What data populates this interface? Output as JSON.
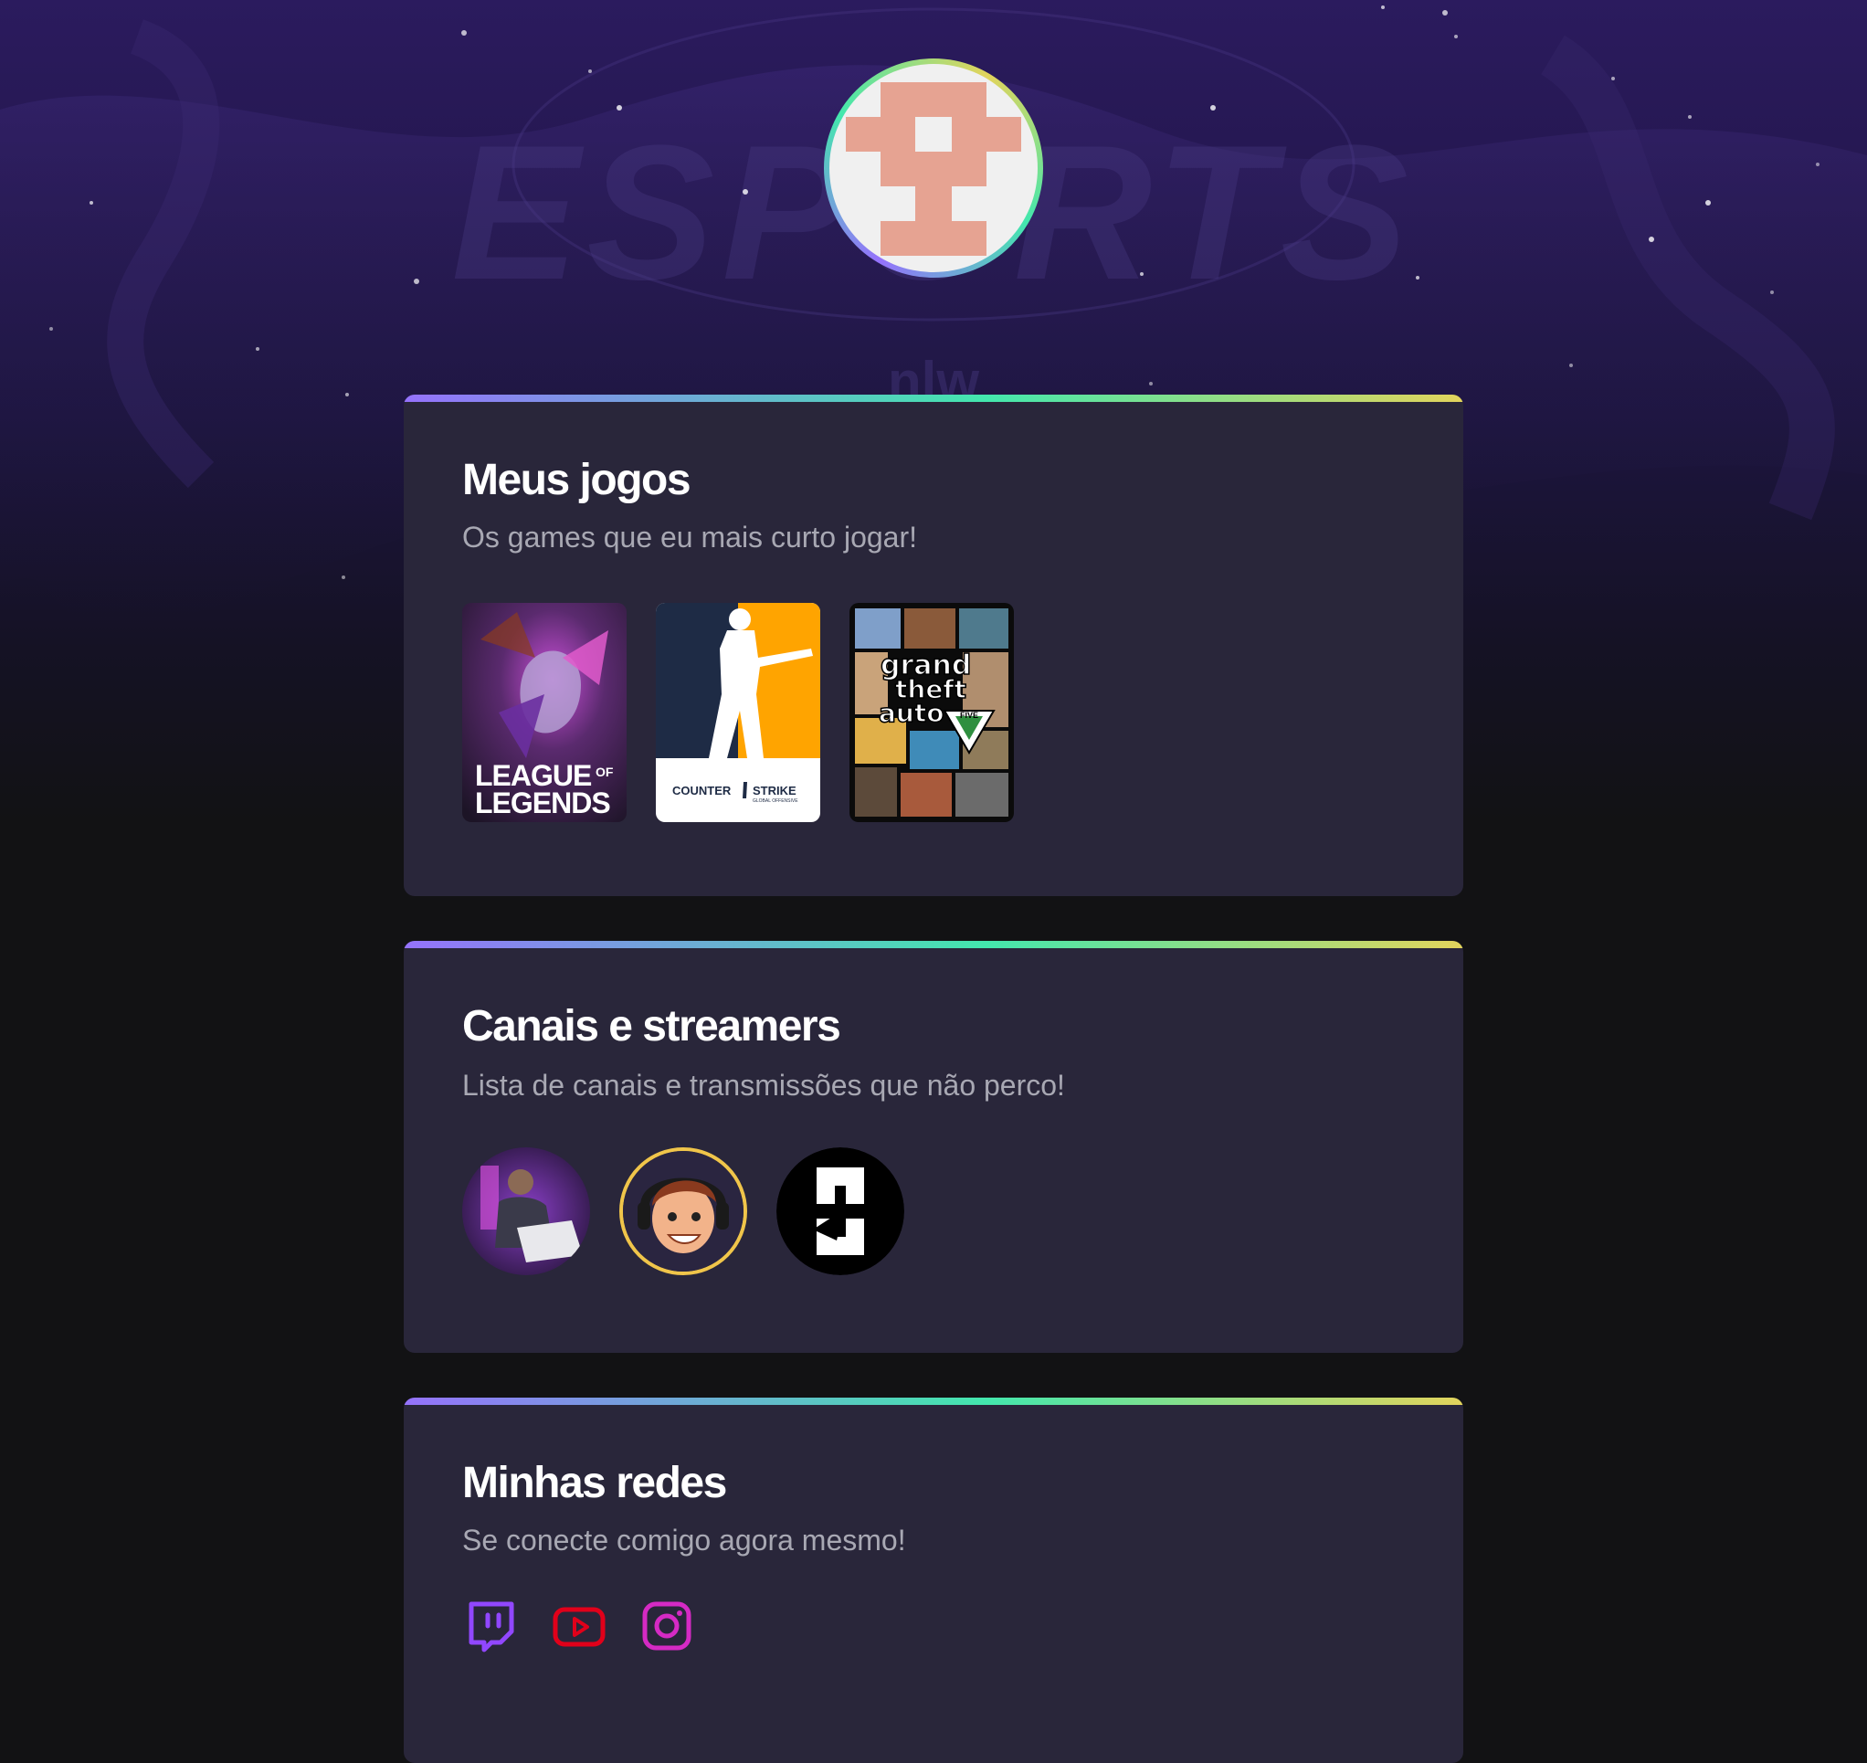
{
  "background": {
    "watermark_text": "ESPORTS",
    "watermark_sub": "nlw"
  },
  "profile": {
    "avatar": "pixel-identicon"
  },
  "sections": {
    "games": {
      "title": "Meus jogos",
      "subtitle": "Os games que eu mais curto jogar!",
      "items": [
        {
          "name": "league-of-legends",
          "line1": "LEAGUE",
          "of": "OF",
          "line2": "LEGENDS"
        },
        {
          "name": "counter-strike",
          "left": "COUNTER",
          "right": "STRIKE",
          "tag": "GLOBAL OFFENSIVE"
        },
        {
          "name": "gta-v",
          "line1": "grand",
          "line2": "theft",
          "line3": "auto",
          "five": "FIVE"
        }
      ]
    },
    "streamers": {
      "title": "Canais e streamers",
      "subtitle": "Lista de canais e transmissões que não perco!",
      "items": [
        "streamer-photo",
        "cartoon-streamer",
        "c-logo"
      ]
    },
    "social": {
      "title": "Minhas redes",
      "subtitle": "Se conecte comigo agora mesmo!",
      "items": [
        {
          "icon": "twitch-icon",
          "color": "#9147ff"
        },
        {
          "icon": "youtube-icon",
          "color": "#e1001a"
        },
        {
          "icon": "instagram-icon",
          "color": "#d52ac4"
        }
      ]
    }
  }
}
